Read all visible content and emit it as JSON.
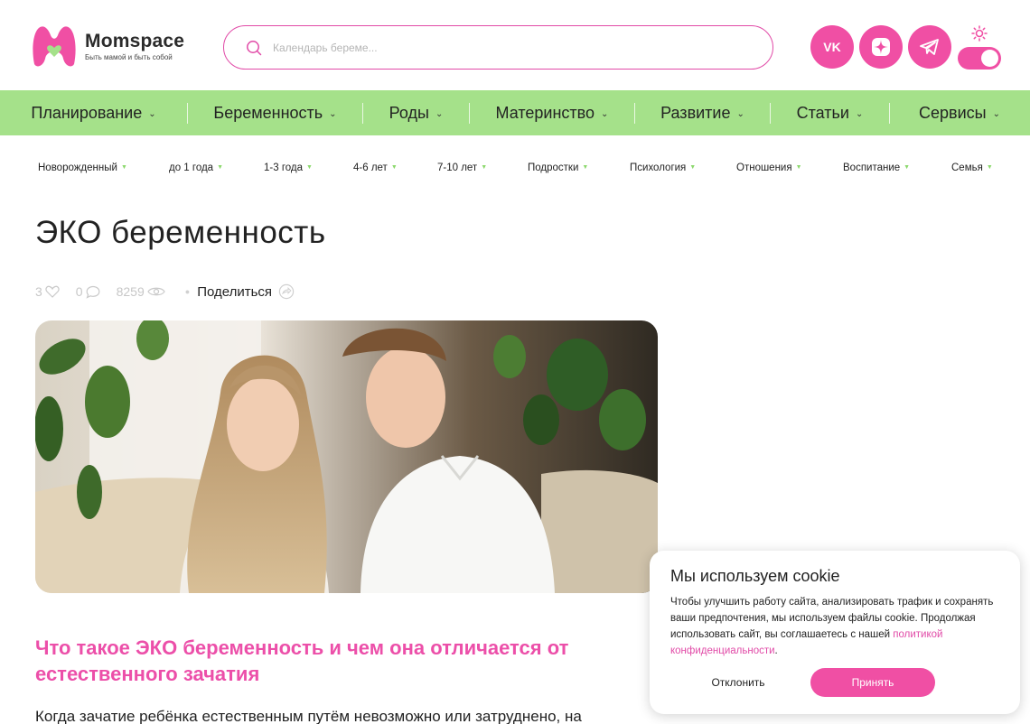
{
  "brand": {
    "name": "Momspace",
    "tagline": "Быть мамой и быть собой",
    "accent": "#f04fa4",
    "green": "#a5e18a"
  },
  "search": {
    "placeholder": "Календарь береме..."
  },
  "social": [
    {
      "icon": "vk-icon"
    },
    {
      "icon": "dzen-icon"
    },
    {
      "icon": "telegram-icon"
    }
  ],
  "theme": {
    "icon": "sun-icon",
    "state": "on"
  },
  "main_nav": [
    "Планирование",
    "Беременность",
    "Роды",
    "Материнство",
    "Развитие",
    "Статьи",
    "Сервисы"
  ],
  "sub_nav": [
    "Новорожденный",
    "до 1 года",
    "1-3 года",
    "4-6 лет",
    "7-10 лет",
    "Подростки",
    "Психология",
    "Отношения",
    "Воспитание",
    "Семья"
  ],
  "article": {
    "title": "ЭКО беременность",
    "likes": "3",
    "comments": "0",
    "views": "8259",
    "share_label": "Поделиться",
    "section_heading": "Что такое ЭКО беременность и чем она отличается от естественного зачатия",
    "paragraph_start": "Когда зачатие ребёнка естественным путём невозможно или затруднено, на"
  },
  "cookie": {
    "title": "Мы используем cookie",
    "text": "Чтобы улучшить работу сайта, анализировать трафик и сохранять ваши предпочтения, мы используем файлы cookie. Продолжая использовать сайт, вы соглашаетесь с нашей ",
    "link": "политикой конфиденциальности",
    "text_end": ".",
    "decline": "Отклонить",
    "accept": "Принять"
  }
}
